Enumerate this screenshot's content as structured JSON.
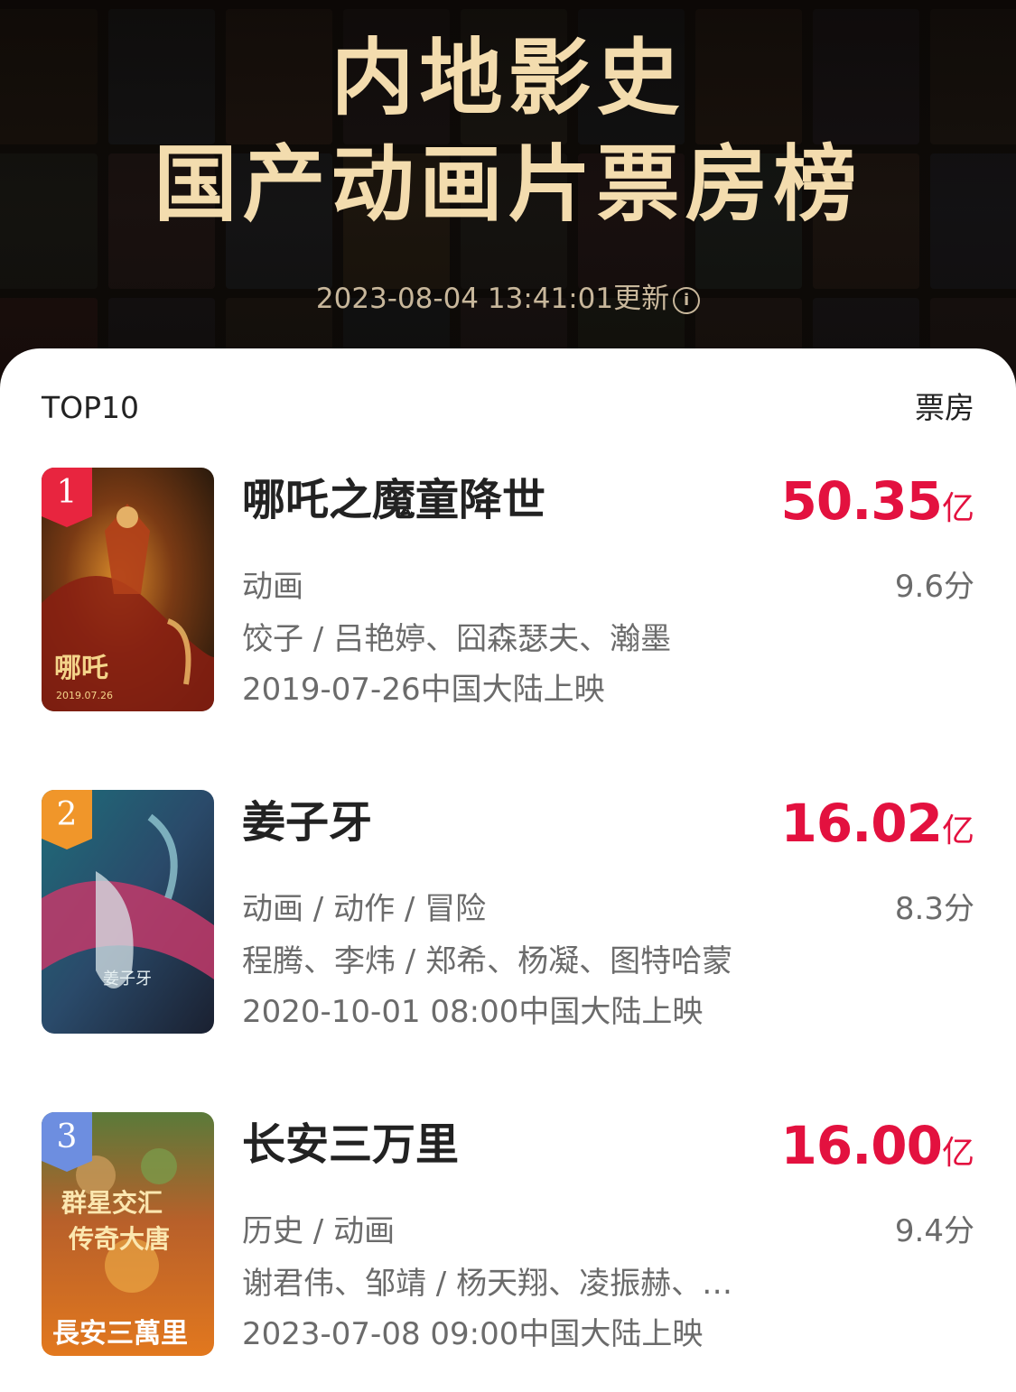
{
  "header": {
    "title_line1": "内地影史",
    "title_line2": "国产动画片票房榜",
    "updated": "2023-08-04 13:41:01更新",
    "info_icon": "i"
  },
  "list": {
    "left_label": "TOP10",
    "right_label": "票房",
    "items": [
      {
        "rank": "1",
        "title": "哪吒之魔童降世",
        "gross_value": "50.35",
        "gross_unit": "亿",
        "genre": "动画",
        "score": "9.6分",
        "people": "饺子 / 吕艳婷、囧森瑟夫、瀚墨",
        "release": "2019-07-26中国大陆上映",
        "poster_label": "哪吒",
        "poster_date": "2019.07.26"
      },
      {
        "rank": "2",
        "title": "姜子牙",
        "gross_value": "16.02",
        "gross_unit": "亿",
        "genre": "动画 / 动作 / 冒险",
        "score": "8.3分",
        "people": "程腾、李炜 / 郑希、杨凝、图特哈蒙",
        "release": "2020-10-01 08:00中国大陆上映",
        "poster_label": "姜子牙"
      },
      {
        "rank": "3",
        "title": "长安三万里",
        "gross_value": "16.00",
        "gross_unit": "亿",
        "genre": "历史 / 动画",
        "score": "9.4分",
        "people": "谢君伟、邹靖 / 杨天翔、凌振赫、…",
        "release": "2023-07-08 09:00中国大陆上映",
        "poster_label_1": "群星交汇",
        "poster_label_2": "传奇大唐",
        "poster_label_3": "長安三萬里"
      }
    ]
  },
  "colors": {
    "gross": "#e3113f",
    "rank1": "#e8253f",
    "rank2": "#f0962a",
    "rank3": "#6d8ee0",
    "title": "#f3dcae"
  }
}
